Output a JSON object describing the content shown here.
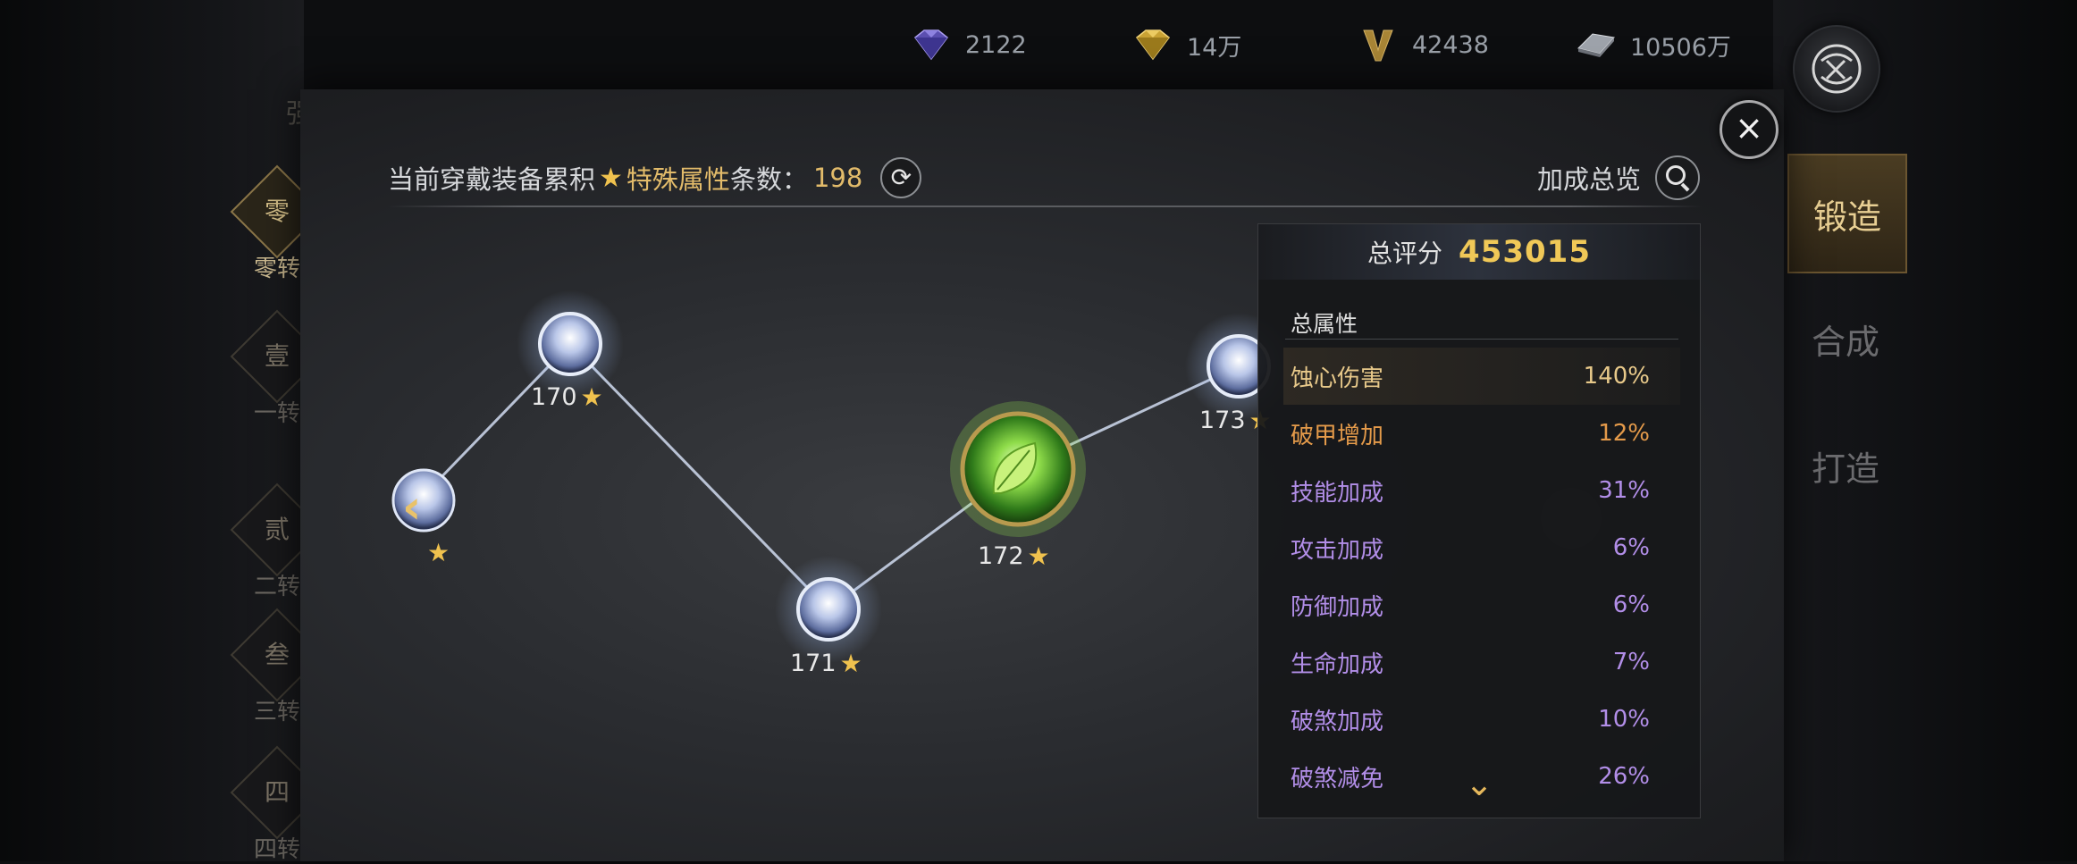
{
  "currency": [
    {
      "icon": "purple-diamond-icon",
      "value": "2122"
    },
    {
      "icon": "gold-diamond-icon",
      "value": "14万"
    },
    {
      "icon": "v-badge-icon",
      "value": "42438"
    },
    {
      "icon": "silver-ingot-icon",
      "value": "10506万"
    }
  ],
  "sidebar": {
    "top_char": "强",
    "items": [
      {
        "glyph": "零",
        "label": "零转"
      },
      {
        "glyph": "壹",
        "label": "一转"
      },
      {
        "glyph": "贰",
        "label": "二转"
      },
      {
        "glyph": "叁",
        "label": "三转"
      },
      {
        "glyph": "四",
        "label": "四转"
      }
    ]
  },
  "header": {
    "prefix": "当前穿戴装备累积",
    "special_attr": "特殊属性",
    "suffix": "条数：",
    "count": "198",
    "overview": "加成总览"
  },
  "tabs": [
    "锻造",
    "合成",
    "打造"
  ],
  "nodes": [
    {
      "label": "170",
      "type": "locked"
    },
    {
      "label": "171",
      "type": "locked"
    },
    {
      "label": "172",
      "type": "active"
    },
    {
      "label": "173",
      "type": "locked"
    }
  ],
  "stats": {
    "total_score_label": "总评分",
    "total_score": "453015",
    "section_title": "总属性",
    "rows": [
      {
        "name": "蚀心伤害",
        "value": "140%",
        "color": "#e8c98a"
      },
      {
        "name": "破甲增加",
        "value": "12%",
        "color": "#e49a4a"
      },
      {
        "name": "技能加成",
        "value": "31%",
        "color": "#b28ee8"
      },
      {
        "name": "攻击加成",
        "value": "6%",
        "color": "#b28ee8"
      },
      {
        "name": "防御加成",
        "value": "6%",
        "color": "#b28ee8"
      },
      {
        "name": "生命加成",
        "value": "7%",
        "color": "#b28ee8"
      },
      {
        "name": "破煞加成",
        "value": "10%",
        "color": "#b28ee8"
      },
      {
        "name": "破煞减免",
        "value": "26%",
        "color": "#b28ee8"
      }
    ]
  }
}
